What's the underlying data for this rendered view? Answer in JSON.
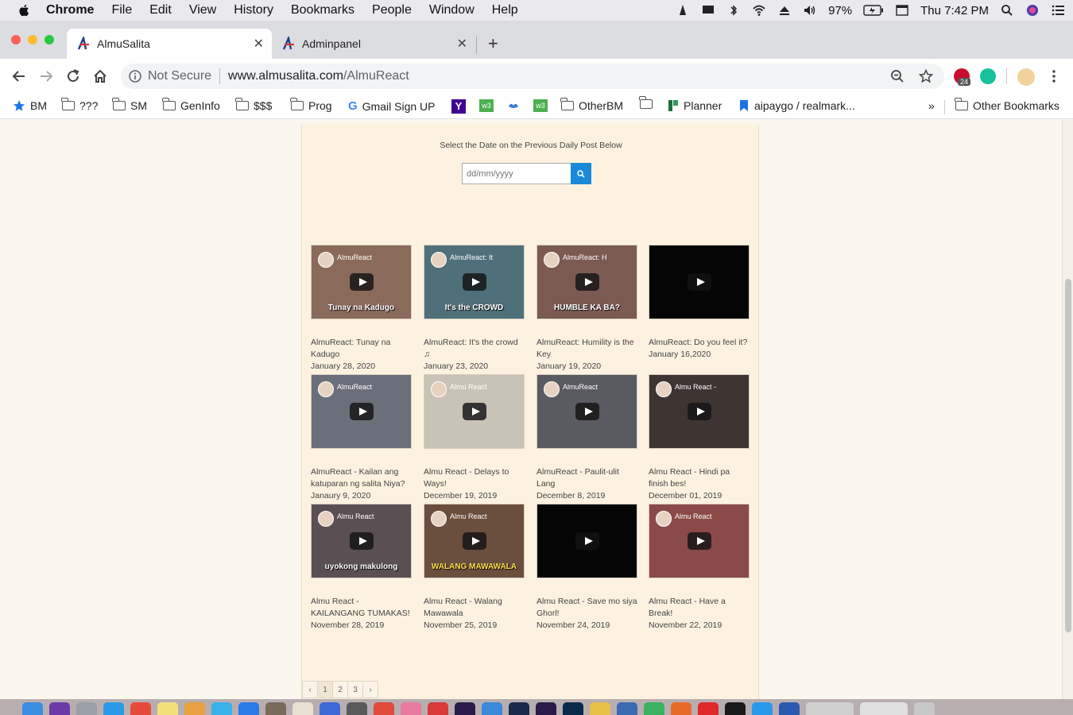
{
  "menubar": {
    "items": [
      "Chrome",
      "File",
      "Edit",
      "View",
      "History",
      "Bookmarks",
      "People",
      "Window",
      "Help"
    ],
    "battery": "97%",
    "clock": "Thu 7:42 PM"
  },
  "tabs": [
    {
      "label": "AlmuSalita",
      "active": true
    },
    {
      "label": "Adminpanel",
      "active": false
    }
  ],
  "address": {
    "security": "Not Secure",
    "domain": "www.almusalita.com",
    "path": "/AlmuReact"
  },
  "extensions": {
    "badge": "24"
  },
  "bookmarks": [
    {
      "label": "BM",
      "icon": "star-icon"
    },
    {
      "label": "???",
      "icon": "folder-icon"
    },
    {
      "label": "SM",
      "icon": "folder-icon"
    },
    {
      "label": "GenInfo",
      "icon": "folder-icon"
    },
    {
      "label": "$$$",
      "icon": "folder-icon"
    },
    {
      "label": "Prog",
      "icon": "folder-icon"
    },
    {
      "label": "Gmail Sign UP",
      "icon": "google-icon"
    },
    {
      "label": "",
      "icon": "yahoo-icon"
    },
    {
      "label": "",
      "icon": "w3-icon"
    },
    {
      "label": "",
      "icon": "bird-icon"
    },
    {
      "label": "",
      "icon": "w3-icon"
    },
    {
      "label": "OtherBM",
      "icon": "folder-icon"
    },
    {
      "label": "",
      "icon": "folder-icon"
    },
    {
      "label": "Planner",
      "icon": "planner-icon"
    },
    {
      "label": "aipaygo / realmark...",
      "icon": "bookmark-icon"
    }
  ],
  "bookmarks_overflow": "»",
  "other_bookmarks": "Other Bookmarks",
  "page": {
    "select_label": "Select the Date on the Previous Daily Post Below",
    "date_placeholder": "dd/mm/yyyy",
    "videos": [
      {
        "title": "AlmuReact: Tunay na Kadugo",
        "date": "January 28, 2020",
        "thumb_title": "AlmuReact",
        "caption": "Tunay na Kadugo",
        "color": "#8a6a5a"
      },
      {
        "title": "AlmuReact: It's the crowd ♫",
        "date": "January 23, 2020",
        "thumb_title": "AlmuReact: It",
        "caption": "It's the CROWD",
        "color": "#4f6f7a"
      },
      {
        "title": "AlmuReact: Humility is the Key",
        "date": "January 19, 2020",
        "thumb_title": "AlmuReact: H",
        "caption": "HUMBLE KA BA?",
        "color": "#7b5a52"
      },
      {
        "title": "AlmuReact: Do you feel it?",
        "date": "January 16,2020",
        "thumb_title": "",
        "caption": "",
        "color": "#050505"
      },
      {
        "title": "AlmuReact - Kailan ang katuparan ng salita Niya?",
        "date": "Janaury 9, 2020",
        "thumb_title": "AlmuReact",
        "caption": "",
        "color": "#6b6f7a"
      },
      {
        "title": "Almu React - Delays to Ways!",
        "date": "December 19, 2019",
        "thumb_title": "Almu React",
        "caption": "",
        "color": "#c9c2b6"
      },
      {
        "title": "AlmuReact - Paulit-ulit Lang",
        "date": "December 8, 2019",
        "thumb_title": "AlmuReact",
        "caption": "",
        "color": "#5a5a62"
      },
      {
        "title": "Almu React - Hindi pa finish bes!",
        "date": "December 01, 2019",
        "thumb_title": "Almu React -",
        "caption": "",
        "color": "#3e3432"
      },
      {
        "title": "Almu React - KAILANGANG TUMAKAS!",
        "date": "November 28, 2019",
        "thumb_title": "Almu React",
        "caption": "uyokong makulong",
        "color": "#5a4f52"
      },
      {
        "title": "Almu React - Walang Mawawala",
        "date": "November 25, 2019",
        "thumb_title": "Almu React",
        "caption": "WALANG MAWAWALA",
        "color": "#6a4e3e"
      },
      {
        "title": "Almu React - Save mo siya Ghorl!",
        "date": "November 24, 2019",
        "thumb_title": "",
        "caption": "",
        "color": "#050505"
      },
      {
        "title": "Almu React - Have a Break!",
        "date": "November 22, 2019",
        "thumb_title": "Almu React",
        "caption": "",
        "color": "#8a4a48"
      }
    ]
  },
  "pagination": [
    "‹",
    "1",
    "2",
    "3",
    "›"
  ],
  "colors": {
    "accent": "#1a8ad8",
    "page_bg": "#fcf7ee",
    "card_bg": "#fdf2df"
  }
}
